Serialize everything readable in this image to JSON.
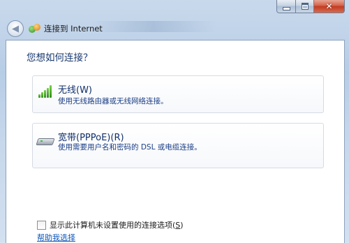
{
  "window": {
    "title": "连接到 Internet"
  },
  "caption_buttons": {
    "minimize_icon": "minimize-icon",
    "maximize_icon": "maximize-icon",
    "close_icon": "close-icon",
    "close_glyph": "✕"
  },
  "nav": {
    "back_glyph": "◀"
  },
  "main": {
    "heading": "您想如何连接？",
    "options": [
      {
        "title": "无线(W)",
        "description": "使用无线路由器或无线网络连接。",
        "icon": "wireless-signal-icon"
      },
      {
        "title": "宽带(PPPoE)(R)",
        "description": "使用需要用户名和密码的 DSL 或电缆连接。",
        "icon": "broadband-modem-icon"
      }
    ],
    "show_unconfigured": {
      "label_prefix": "显示此计算机未设置使用的连接选项(",
      "label_accesskey": "S",
      "label_suffix": ")",
      "checked": false
    },
    "help_link": "帮助我选择"
  },
  "colors": {
    "heading": "#17386f",
    "link": "#0f56b8",
    "close_button": "#c23a1f"
  }
}
